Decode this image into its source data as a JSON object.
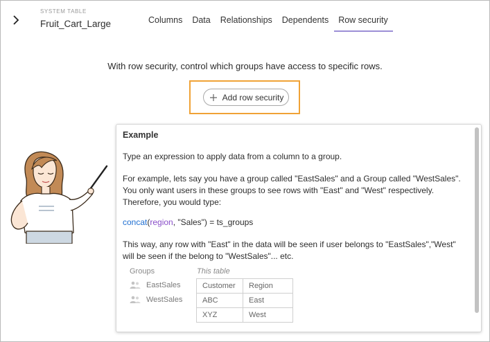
{
  "header": {
    "collapse_icon": "chevron-right-icon",
    "table_type": "SYSTEM TABLE",
    "table_name": "Fruit_Cart_Large",
    "tabs": [
      {
        "label": "Columns",
        "active": false
      },
      {
        "label": "Data",
        "active": false
      },
      {
        "label": "Relationships",
        "active": false
      },
      {
        "label": "Dependents",
        "active": false
      },
      {
        "label": "Row security",
        "active": true
      }
    ],
    "active_tab_color": "#9b8ed6"
  },
  "main": {
    "intro": "With row security, control which groups have access to specific rows.",
    "add_button_label": "Add row security",
    "add_button_icon": "plus-icon",
    "highlight_color": "#f0a236"
  },
  "example": {
    "title": "Example",
    "line1": "Type an expression to apply data from a column to a group.",
    "line2": "For example, lets say you have a group called \"EastSales\" and a Group called \"WestSales\". You only want users in these groups to see rows with \"East\" and \"West\" respectively. Therefore, you would type:",
    "formula": {
      "fn": "concat",
      "open": "(",
      "arg": "region",
      "rest": ", \"Sales\") = ts_groups"
    },
    "line3": "This way, any row with \"East\" in the data will be seen if user belongs to \"EastSales\",\"West\" will be seen if the belong to \"WestSales\"... etc.",
    "groups_header": "Groups",
    "groups": [
      "EastSales",
      "WestSales"
    ],
    "group_icon": "users-icon",
    "table_caption": "This table",
    "table": {
      "headers": [
        "Customer",
        "Region"
      ],
      "rows": [
        [
          "ABC",
          "East"
        ],
        [
          "XYZ",
          "West"
        ]
      ]
    },
    "colors": {
      "function": "#1f6fd1",
      "argument": "#8a4fc9"
    }
  }
}
